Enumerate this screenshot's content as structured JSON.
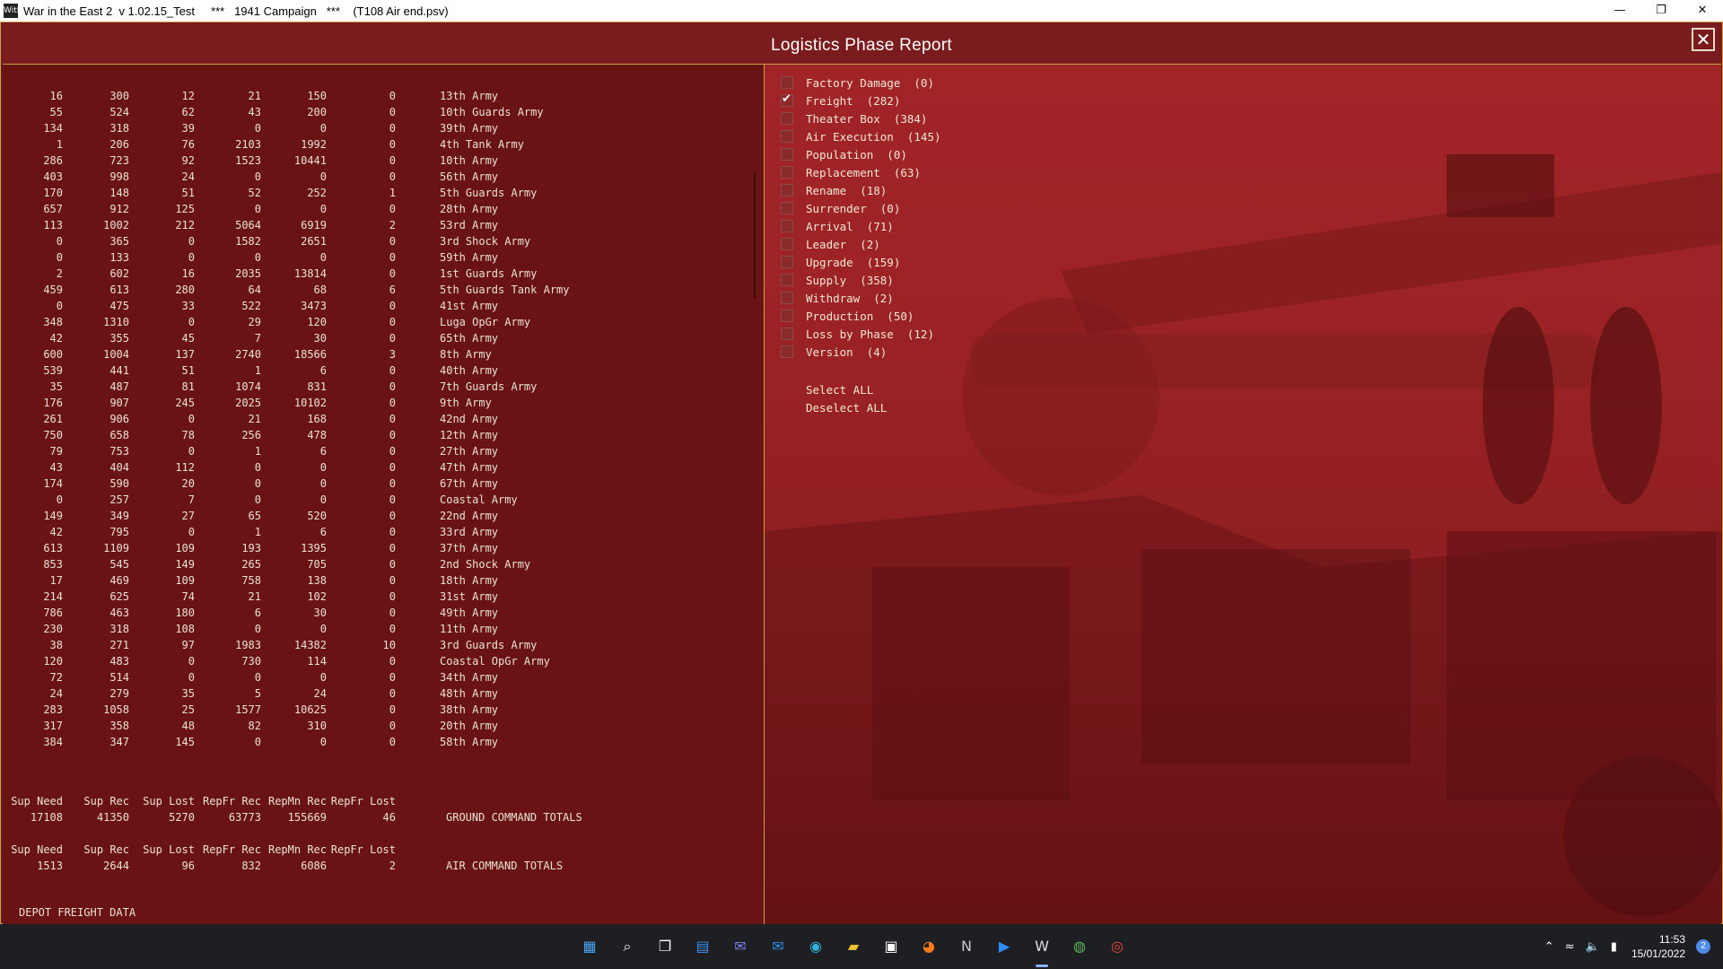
{
  "window": {
    "title": "War in the East 2  v 1.02.15_Test     ***   1941 Campaign   ***    (T108 Air end.psv)",
    "app_icon": "WitE"
  },
  "report": {
    "title": "Logistics Phase Report",
    "close_label": "✕"
  },
  "rows": [
    [
      "16",
      "300",
      "12",
      "21",
      "150",
      "0",
      "13th Army"
    ],
    [
      "55",
      "524",
      "62",
      "43",
      "200",
      "0",
      "10th Guards Army"
    ],
    [
      "134",
      "318",
      "39",
      "0",
      "0",
      "0",
      "39th Army"
    ],
    [
      "1",
      "206",
      "76",
      "2103",
      "1992",
      "0",
      "4th Tank Army"
    ],
    [
      "286",
      "723",
      "92",
      "1523",
      "10441",
      "0",
      "10th Army"
    ],
    [
      "403",
      "998",
      "24",
      "0",
      "0",
      "0",
      "56th Army"
    ],
    [
      "170",
      "148",
      "51",
      "52",
      "252",
      "1",
      "5th Guards Army"
    ],
    [
      "657",
      "912",
      "125",
      "0",
      "0",
      "0",
      "28th Army"
    ],
    [
      "113",
      "1002",
      "212",
      "5064",
      "6919",
      "2",
      "53rd Army"
    ],
    [
      "0",
      "365",
      "0",
      "1582",
      "2651",
      "0",
      "3rd Shock Army"
    ],
    [
      "0",
      "133",
      "0",
      "0",
      "0",
      "0",
      "59th Army"
    ],
    [
      "2",
      "602",
      "16",
      "2035",
      "13814",
      "0",
      "1st Guards Army"
    ],
    [
      "459",
      "613",
      "280",
      "64",
      "68",
      "6",
      "5th Guards Tank Army"
    ],
    [
      "0",
      "475",
      "33",
      "522",
      "3473",
      "0",
      "41st Army"
    ],
    [
      "348",
      "1310",
      "0",
      "29",
      "120",
      "0",
      "Luga OpGr Army"
    ],
    [
      "42",
      "355",
      "45",
      "7",
      "30",
      "0",
      "65th Army"
    ],
    [
      "600",
      "1004",
      "137",
      "2740",
      "18566",
      "3",
      "8th Army"
    ],
    [
      "539",
      "441",
      "51",
      "1",
      "6",
      "0",
      "40th Army"
    ],
    [
      "35",
      "487",
      "81",
      "1074",
      "831",
      "0",
      "7th Guards Army"
    ],
    [
      "176",
      "907",
      "245",
      "2025",
      "10102",
      "0",
      "9th Army"
    ],
    [
      "261",
      "906",
      "0",
      "21",
      "168",
      "0",
      "42nd Army"
    ],
    [
      "750",
      "658",
      "78",
      "256",
      "478",
      "0",
      "12th Army"
    ],
    [
      "79",
      "753",
      "0",
      "1",
      "6",
      "0",
      "27th Army"
    ],
    [
      "43",
      "404",
      "112",
      "0",
      "0",
      "0",
      "47th Army"
    ],
    [
      "174",
      "590",
      "20",
      "0",
      "0",
      "0",
      "67th Army"
    ],
    [
      "0",
      "257",
      "7",
      "0",
      "0",
      "0",
      "Coastal Army"
    ],
    [
      "149",
      "349",
      "27",
      "65",
      "520",
      "0",
      "22nd Army"
    ],
    [
      "42",
      "795",
      "0",
      "1",
      "6",
      "0",
      "33rd Army"
    ],
    [
      "613",
      "1109",
      "109",
      "193",
      "1395",
      "0",
      "37th Army"
    ],
    [
      "853",
      "545",
      "149",
      "265",
      "705",
      "0",
      "2nd Shock Army"
    ],
    [
      "17",
      "469",
      "109",
      "758",
      "138",
      "0",
      "18th Army"
    ],
    [
      "214",
      "625",
      "74",
      "21",
      "102",
      "0",
      "31st Army"
    ],
    [
      "786",
      "463",
      "180",
      "6",
      "30",
      "0",
      "49th Army"
    ],
    [
      "230",
      "318",
      "108",
      "0",
      "0",
      "0",
      "11th Army"
    ],
    [
      "38",
      "271",
      "97",
      "1983",
      "14382",
      "10",
      "3rd Guards Army"
    ],
    [
      "120",
      "483",
      "0",
      "730",
      "114",
      "0",
      "Coastal OpGr Army"
    ],
    [
      "72",
      "514",
      "0",
      "0",
      "0",
      "0",
      "34th Army"
    ],
    [
      "24",
      "279",
      "35",
      "5",
      "24",
      "0",
      "48th Army"
    ],
    [
      "283",
      "1058",
      "25",
      "1577",
      "10625",
      "0",
      "38th Army"
    ],
    [
      "317",
      "358",
      "48",
      "82",
      "310",
      "0",
      "20th Army"
    ],
    [
      "384",
      "347",
      "145",
      "0",
      "0",
      "0",
      "58th Army"
    ]
  ],
  "totals_headers": [
    "Sup Need",
    "Sup Rec",
    "Sup Lost",
    "RepFr Rec",
    "RepMn Rec",
    "RepFr Lost"
  ],
  "ground_totals": {
    "values": [
      "17108",
      "41350",
      "5270",
      "63773",
      "155669",
      "46"
    ],
    "label": "GROUND COMMAND TOTALS"
  },
  "air_totals": {
    "values": [
      "1513",
      "2644",
      "96",
      "832",
      "6086",
      "2"
    ],
    "label": "AIR COMMAND TOTALS"
  },
  "depot_label": "DEPOT FREIGHT DATA",
  "filters": [
    {
      "label": "Factory Damage  (0)",
      "checked": false
    },
    {
      "label": "Freight  (282)",
      "checked": true
    },
    {
      "label": "Theater Box  (384)",
      "checked": false
    },
    {
      "label": "Air Execution  (145)",
      "checked": false
    },
    {
      "label": "Population  (0)",
      "checked": false
    },
    {
      "label": "Replacement  (63)",
      "checked": false
    },
    {
      "label": "Rename  (18)",
      "checked": false
    },
    {
      "label": "Surrender  (0)",
      "checked": false
    },
    {
      "label": "Arrival  (71)",
      "checked": false
    },
    {
      "label": "Leader  (2)",
      "checked": false
    },
    {
      "label": "Upgrade  (159)",
      "checked": false
    },
    {
      "label": "Supply  (358)",
      "checked": false
    },
    {
      "label": "Withdraw  (2)",
      "checked": false
    },
    {
      "label": "Production  (50)",
      "checked": false
    },
    {
      "label": "Loss by Phase  (12)",
      "checked": false
    },
    {
      "label": "Version  (4)",
      "checked": false
    }
  ],
  "select_all": "Select ALL",
  "deselect_all": "Deselect ALL",
  "taskbar": {
    "apps": [
      {
        "name": "start-icon",
        "glyph": "▦",
        "color": "#4aa3f0"
      },
      {
        "name": "search-icon",
        "glyph": "⌕",
        "color": "#ffffff"
      },
      {
        "name": "task-view-icon",
        "glyph": "❐",
        "color": "#ffffff"
      },
      {
        "name": "widgets-icon",
        "glyph": "▤",
        "color": "#3b8ff0"
      },
      {
        "name": "teams-chat-icon",
        "glyph": "✉",
        "color": "#7b83eb"
      },
      {
        "name": "mail-icon",
        "glyph": "✉",
        "color": "#2f8fe6"
      },
      {
        "name": "edge-icon",
        "glyph": "◉",
        "color": "#2fb3d8"
      },
      {
        "name": "file-explorer-icon",
        "glyph": "▰",
        "color": "#f2c12e"
      },
      {
        "name": "store-icon",
        "glyph": "▣",
        "color": "#ffffff"
      },
      {
        "name": "firefox-icon",
        "glyph": "◕",
        "color": "#ff7a1a"
      },
      {
        "name": "notepad-n-icon",
        "glyph": "N",
        "color": "#cccccc"
      },
      {
        "name": "zoom-icon",
        "glyph": "▶",
        "color": "#2d8cff"
      },
      {
        "name": "wite-game-icon",
        "glyph": "W",
        "color": "#dddddd"
      },
      {
        "name": "globe-app-icon",
        "glyph": "◍",
        "color": "#5cb85c"
      },
      {
        "name": "chrome-icon",
        "glyph": "◎",
        "color": "#e8453c"
      }
    ],
    "time": "11:53",
    "date": "15/01/2022",
    "notifications": "2"
  }
}
